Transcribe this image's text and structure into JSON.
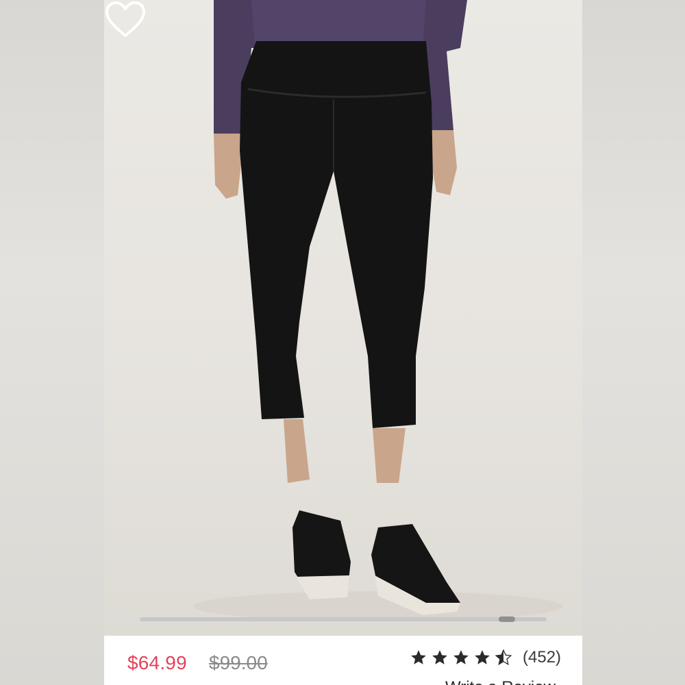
{
  "product": {
    "sale_price": "$64.99",
    "original_price": "$99.00",
    "rating": {
      "stars": 4.5,
      "max_stars": 5,
      "review_count": "(452)"
    },
    "write_review_label": "Write a Review"
  },
  "gallery": {
    "wishlist_icon": "heart-outline-icon",
    "scroll_position": 0.92
  },
  "colors": {
    "sale_price": "#e3425a",
    "original_price": "#8a8a8a",
    "scroll_track": "#c7c7c9",
    "scroll_thumb": "#8e8e93"
  }
}
